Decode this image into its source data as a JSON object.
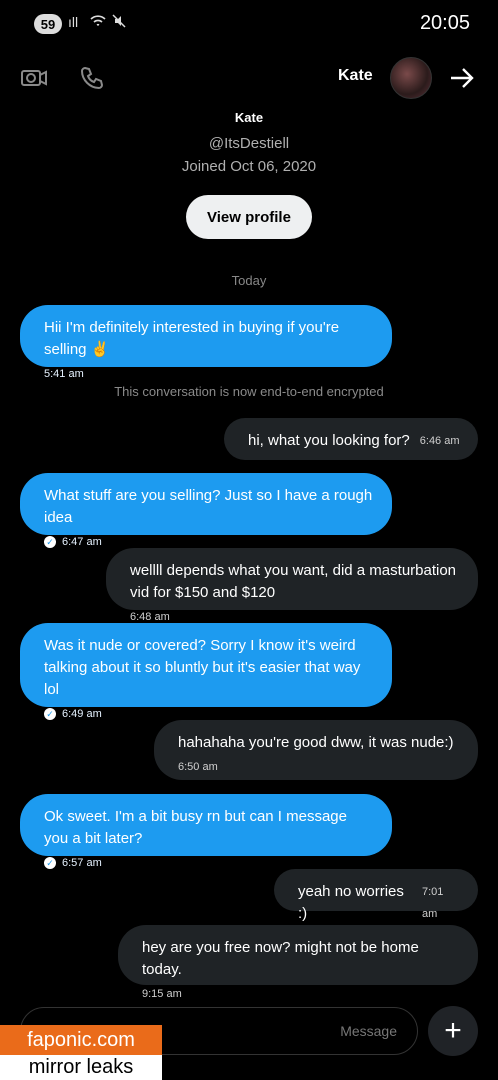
{
  "status": {
    "battery": "59",
    "time": "20:05"
  },
  "header": {
    "name": "Kate"
  },
  "profile": {
    "name": "Kate",
    "handle": "@ItsDestiell",
    "joined": "Joined Oct 06, 2020",
    "view_profile": "View profile"
  },
  "day_separator": "Today",
  "system_message": "This conversation is now end-to-end encrypted",
  "messages": [
    {
      "dir": "out",
      "text": "Hii I'm definitely interested in buying if you're selling ✌️",
      "time": "5:41 am"
    },
    {
      "dir": "in",
      "text": "hi, what you looking for?",
      "time": "6:46 am"
    },
    {
      "dir": "out",
      "text": "What stuff are you selling? Just so I have a rough idea",
      "time": "6:47 am"
    },
    {
      "dir": "in",
      "text": "wellll depends what you want, did a masturbation vid for $150 and $120",
      "time": "6:48 am"
    },
    {
      "dir": "out",
      "text": "Was it nude or covered? Sorry I know it's weird talking about it so bluntly but it's easier that way lol",
      "time": "6:49 am"
    },
    {
      "dir": "in",
      "text": "hahahaha you're good dww, it was nude:)",
      "time": "6:50 am"
    },
    {
      "dir": "out",
      "text": "Ok sweet. I'm a bit busy rn but can I message you a bit later?",
      "time": "6:57 am"
    },
    {
      "dir": "in",
      "text": "yeah no worries :)",
      "time": "7:01 am"
    },
    {
      "dir": "in",
      "text": "hey are you free now? might not be home today.",
      "time": "9:15 am"
    }
  ],
  "composer": {
    "placeholder": "Message"
  },
  "watermark": {
    "line1": "faponic.com",
    "line2": "mirror leaks"
  }
}
